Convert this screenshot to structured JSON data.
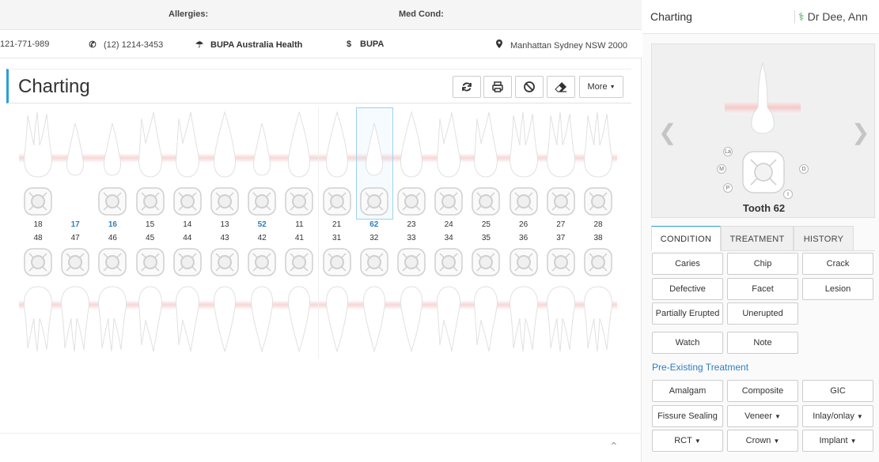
{
  "header": {
    "allergies_label": "Allergies:",
    "med_cond_label": "Med Cond:"
  },
  "patient_info": {
    "phone1": "121-771-989",
    "phone2": "(12) 1214-3453",
    "insurer": "BUPA Australia Health",
    "fund": "BUPA",
    "address": "Manhattan Sydney NSW 2000"
  },
  "main": {
    "title": "Charting",
    "more_label": "More",
    "upper_numbers": [
      "18",
      "17",
      "16",
      "15",
      "14",
      "13",
      "52",
      "11",
      "21",
      "62",
      "23",
      "24",
      "25",
      "26",
      "27",
      "28"
    ],
    "lower_numbers": [
      "48",
      "47",
      "46",
      "45",
      "44",
      "43",
      "42",
      "41",
      "31",
      "32",
      "33",
      "34",
      "35",
      "36",
      "37",
      "38"
    ],
    "highlighted_upper": [
      "17",
      "16",
      "52",
      "62"
    ],
    "selected_tooth": "62"
  },
  "sidebar": {
    "title": "Charting",
    "doctor": "Dr Dee, Ann",
    "tooth_label": "Tooth 62",
    "surfaces": [
      "La",
      "M",
      "D",
      "P",
      "I"
    ],
    "tabs": [
      {
        "label": "CONDITION",
        "active": true
      },
      {
        "label": "TREATMENT",
        "active": false
      },
      {
        "label": "HISTORY",
        "active": false
      }
    ],
    "condition_buttons": [
      {
        "label": "Caries"
      },
      {
        "label": "Chip"
      },
      {
        "label": "Crack"
      },
      {
        "label": "Defective"
      },
      {
        "label": "Facet"
      },
      {
        "label": "Lesion"
      },
      {
        "label": "Partially Erupted"
      },
      {
        "label": "Unerupted"
      }
    ],
    "note_buttons": [
      {
        "label": "Watch"
      },
      {
        "label": "Note"
      }
    ],
    "pre_existing_label": "Pre-Existing Treatment",
    "treatment_buttons": [
      {
        "label": "Amalgam",
        "dropdown": false
      },
      {
        "label": "Composite",
        "dropdown": false
      },
      {
        "label": "GIC",
        "dropdown": false
      },
      {
        "label": "Fissure Sealing",
        "dropdown": false
      },
      {
        "label": "Veneer",
        "dropdown": true
      },
      {
        "label": "Inlay/onlay",
        "dropdown": true
      },
      {
        "label": "RCT",
        "dropdown": true
      },
      {
        "label": "Crown",
        "dropdown": true
      },
      {
        "label": "Implant",
        "dropdown": true
      }
    ]
  },
  "colors": {
    "accent": "#2a9fd6",
    "link_blue": "#2f7fc1",
    "doctor_icon": "#3ea34a",
    "gum_pink": "#f6d0d0"
  }
}
